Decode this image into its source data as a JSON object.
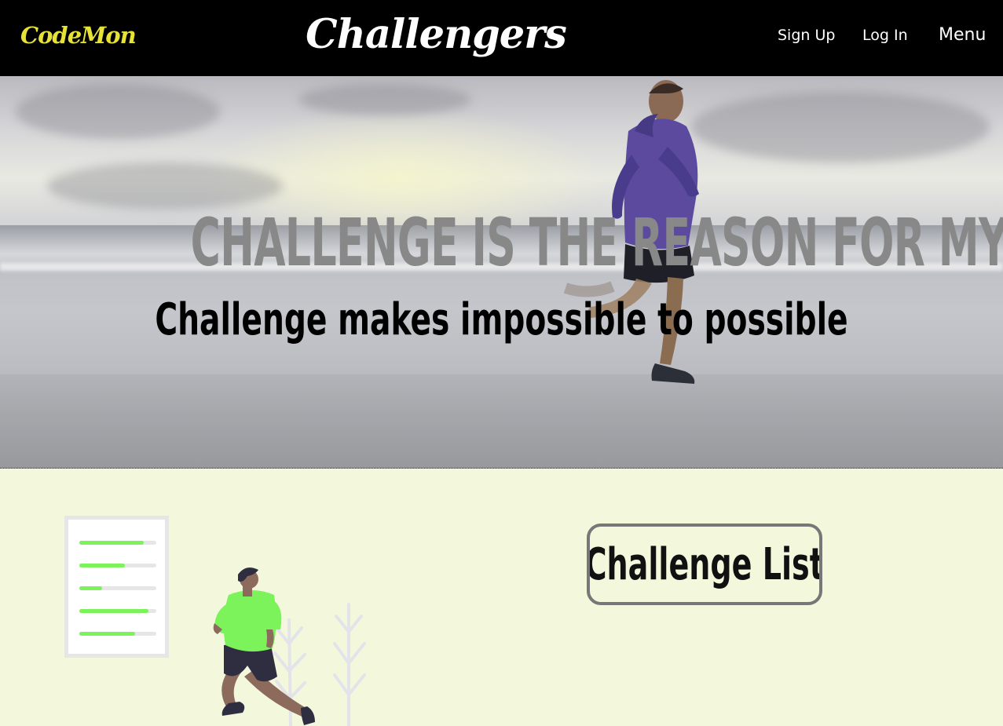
{
  "header": {
    "logo": "CodeMon",
    "title": "Challengers",
    "nav": {
      "sign_up": "Sign Up",
      "log_in": "Log In",
      "menu": "Menu"
    }
  },
  "hero": {
    "headline": "CHALLENGE IS THE REASON FOR MY LIFE",
    "subline": "Challenge makes impossible to possible"
  },
  "checklist": {
    "progress": [
      0.84,
      0.59,
      0.3,
      0.9,
      0.72
    ]
  },
  "main": {
    "challenge_list_label": "Challenge List"
  },
  "colors": {
    "header_bg": "#000000",
    "logo": "#e7e335",
    "section_bg": "#f3f8dc",
    "accent_green": "#7cf25b",
    "headline_gray": "#888888"
  }
}
